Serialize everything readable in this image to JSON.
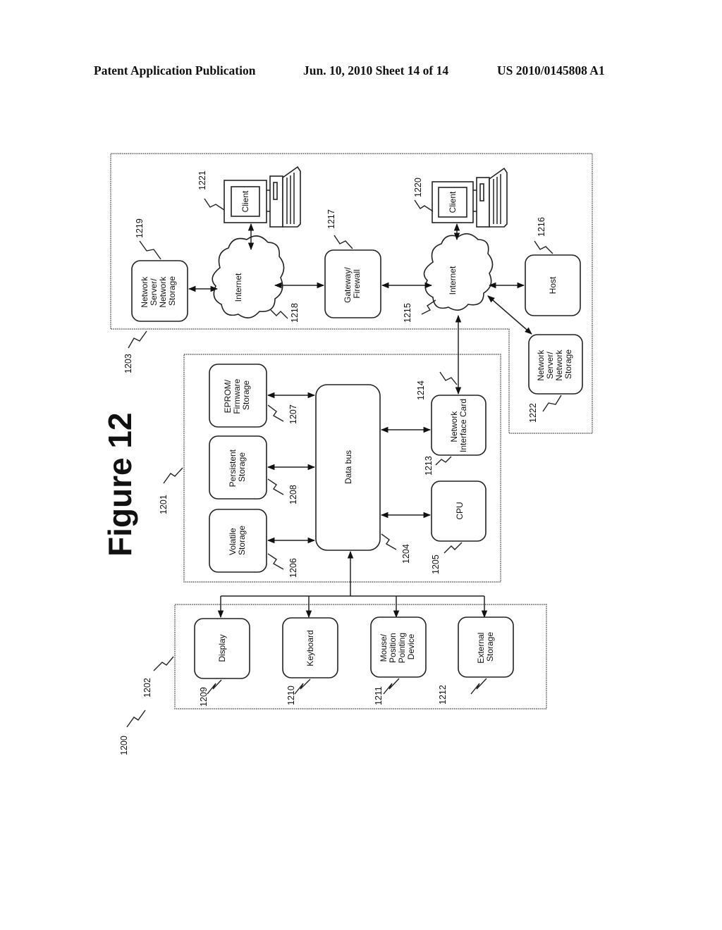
{
  "header": {
    "left": "Patent Application Publication",
    "middle": "Jun. 10, 2010  Sheet 14 of 14",
    "right": "US 2010/0145808 A1"
  },
  "figure": {
    "title": "Figure 12",
    "orientation": "rotated 90° counter-clockwise",
    "system_ref": "1200",
    "regions": {
      "network": {
        "ref": "1203"
      },
      "computer": {
        "ref": "1201"
      },
      "peripherals": {
        "ref": "1202"
      }
    },
    "nodes": {
      "net_server_1219": {
        "label": [
          "Network",
          "Server/",
          "Network",
          "Storage"
        ],
        "ref": "1219"
      },
      "internet_1218": {
        "label": [
          "Internet"
        ],
        "ref": "1218"
      },
      "client_1221": {
        "label": [
          "Client"
        ],
        "ref": "1221"
      },
      "gateway_1217": {
        "label": [
          "Gateway/",
          "Firewall"
        ],
        "ref": "1217"
      },
      "internet_1215": {
        "label": [
          "Internet"
        ],
        "ref": "1215"
      },
      "client_1220": {
        "label": [
          "Client"
        ],
        "ref": "1220"
      },
      "host_1216": {
        "label": [
          "Host"
        ],
        "ref": "1216"
      },
      "net_server_1222": {
        "label": [
          "Network",
          "Server/",
          "Network",
          "Storage"
        ],
        "ref": "1222"
      },
      "eprom_1207": {
        "label": [
          "EPROM/",
          "Firmware",
          "Storage"
        ],
        "ref": "1207"
      },
      "persistent_1208": {
        "label": [
          "Persistent",
          "Storage"
        ],
        "ref": "1208"
      },
      "volatile_1206": {
        "label": [
          "Volatile",
          "Storage"
        ],
        "ref": "1206"
      },
      "databus_1204": {
        "label": [
          "Data bus"
        ],
        "ref": "1204"
      },
      "nic_1213": {
        "label": [
          "Network",
          "Interface Card"
        ],
        "ref": "1213"
      },
      "cpu_1205": {
        "label": [
          "CPU"
        ],
        "ref": "1205"
      },
      "nic_link_1214": {
        "ref": "1214"
      },
      "display_1209": {
        "label": [
          "Display"
        ],
        "ref": "1209"
      },
      "keyboard_1210": {
        "label": [
          "Keyboard"
        ],
        "ref": "1210"
      },
      "mouse_1211": {
        "label": [
          "Mouse/",
          "Position",
          "Pointing",
          "Device"
        ],
        "ref": "1211"
      },
      "external_1212": {
        "label": [
          "External",
          "Storage"
        ],
        "ref": "1212"
      }
    },
    "connections": [
      [
        "net_server_1219",
        "internet_1218",
        "bidirectional"
      ],
      [
        "internet_1218",
        "client_1221",
        "bidirectional"
      ],
      [
        "internet_1218",
        "gateway_1217",
        "bidirectional"
      ],
      [
        "gateway_1217",
        "internet_1215",
        "bidirectional"
      ],
      [
        "internet_1215",
        "client_1220",
        "bidirectional"
      ],
      [
        "internet_1215",
        "host_1216",
        "bidirectional"
      ],
      [
        "internet_1215",
        "net_server_1222",
        "bidirectional"
      ],
      [
        "internet_1215",
        "nic_1213",
        "bidirectional"
      ],
      [
        "eprom_1207",
        "databus_1204",
        "bidirectional"
      ],
      [
        "persistent_1208",
        "databus_1204",
        "bidirectional"
      ],
      [
        "volatile_1206",
        "databus_1204",
        "bidirectional"
      ],
      [
        "databus_1204",
        "nic_1213",
        "bidirectional"
      ],
      [
        "databus_1204",
        "cpu_1205",
        "bidirectional"
      ],
      [
        "peripherals",
        "databus_1204",
        "to_bus"
      ],
      [
        "bus_tree",
        "display_1209",
        "to_device"
      ],
      [
        "bus_tree",
        "keyboard_1210",
        "to_device"
      ],
      [
        "bus_tree",
        "mouse_1211",
        "to_device"
      ],
      [
        "bus_tree",
        "external_1212",
        "to_device"
      ]
    ]
  }
}
